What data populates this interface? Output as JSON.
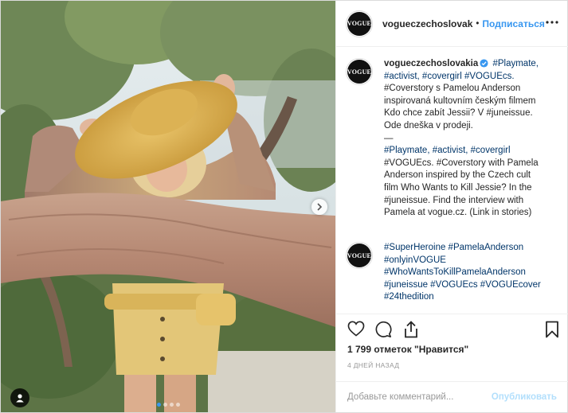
{
  "brand": {
    "logo_text": "VOGUE",
    "link_color": "#3897f0",
    "hashtag_color": "#003569"
  },
  "header": {
    "username": "vogueczechoslovak",
    "separator": "•",
    "follow_label": "Подписаться",
    "more_icon": "ellipsis-icon"
  },
  "caption": {
    "username": "vogueczechoslovakia",
    "lines_cs": [
      "#Playmate,",
      "#activist, #covergirl #VOGUEcs.",
      "#Coverstory s Pamelou Anderson",
      "inspirovaná kultovním českým filmem",
      "Kdo chce zabít Jessii? V #juneissue.",
      "Ode dneška v prodeji."
    ],
    "divider": "—",
    "lines_en": [
      "#Playmate, #activist, #covergirl",
      "#VOGUEcs. #Coverstory with Pamela",
      "Anderson inspired by the Czech cult",
      "film Who Wants to Kill Jessie? In the",
      "#juneissue. Find the interview with",
      "Pamela at vogue.cz. (Link in stories)"
    ]
  },
  "comment": {
    "lines": [
      "#SuperHeroine #PamelaAnderson",
      "#onlyinVOGUE",
      "#WhoWantsToKillPamelaAnderson",
      "#juneissue #VOGUEcs #VOGUEcover",
      "#24thedition"
    ]
  },
  "actions": {
    "like_icon": "heart-icon",
    "comment_icon": "comment-icon",
    "share_icon": "share-icon",
    "save_icon": "bookmark-icon"
  },
  "likes_text": "1 799 отметок \"Нравится\"",
  "time_text": "4 дней назад",
  "add_comment": {
    "placeholder": "Добавьте комментарий...",
    "publish_label": "Опубликовать"
  },
  "carousel": {
    "dots": 4,
    "active_index": 0
  }
}
